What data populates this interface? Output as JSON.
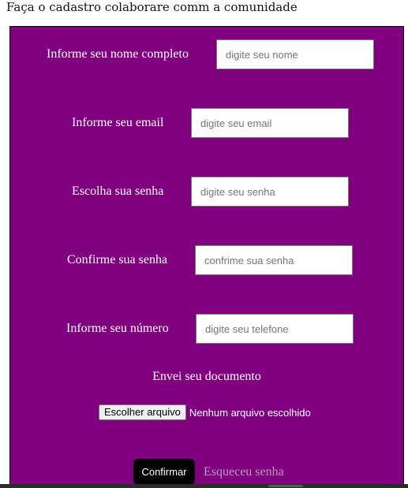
{
  "page": {
    "heading": "Faça o cadastro colaborare comm a comunidade"
  },
  "form": {
    "fields": [
      {
        "label": "Informe seu nome completo",
        "placeholder": "digite seu nome",
        "value": ""
      },
      {
        "label": "Informe seu email",
        "placeholder": "digite seu email",
        "value": ""
      },
      {
        "label": "Escolha sua senha",
        "placeholder": "digite seu senha",
        "value": ""
      },
      {
        "label": "Confirme sua senha",
        "placeholder": "confrime sua senha",
        "value": ""
      },
      {
        "label": "Informe seu número",
        "placeholder": "digite seu telefone",
        "value": ""
      }
    ],
    "document_label": "Envei seu documento",
    "file_button_label": "Escolher arquivo",
    "file_status": "Nenhum arquivo escolhido",
    "confirm_label": "Confirmar",
    "forgot_label": "Esqueceu senha"
  },
  "colors": {
    "panel_background": "#800080",
    "text": "#ffffff",
    "confirm_background": "#000000",
    "forgot_link": "#b7a0b7"
  }
}
